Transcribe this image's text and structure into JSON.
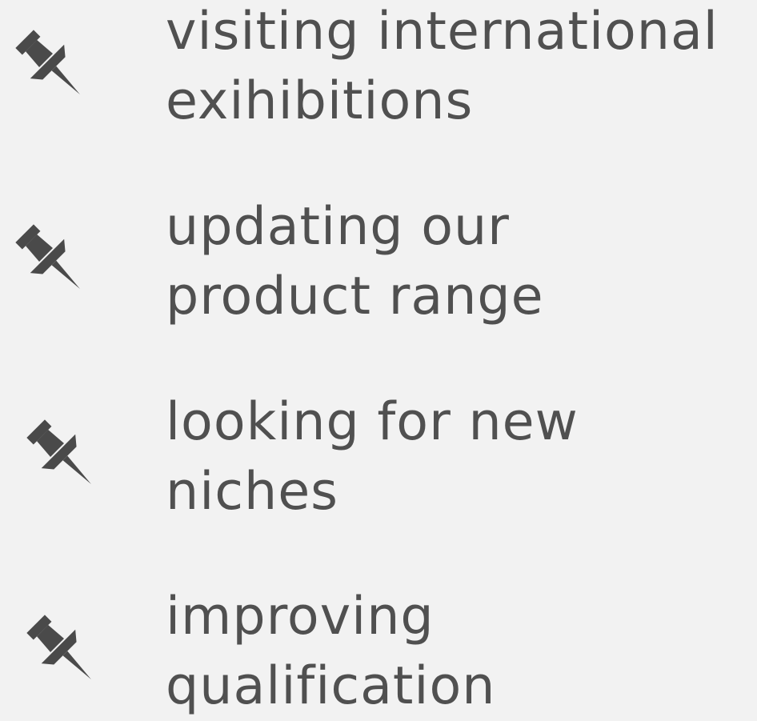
{
  "icon": {
    "name": "pushpin-icon",
    "color": "#4a4a4a"
  },
  "items": [
    {
      "lines": [
        "visiting international",
        "exihibitions"
      ]
    },
    {
      "lines": [
        "updating our",
        "product range"
      ]
    },
    {
      "lines": [
        "looking for new",
        "niches"
      ]
    },
    {
      "lines": [
        "improving",
        "qualification"
      ]
    }
  ]
}
